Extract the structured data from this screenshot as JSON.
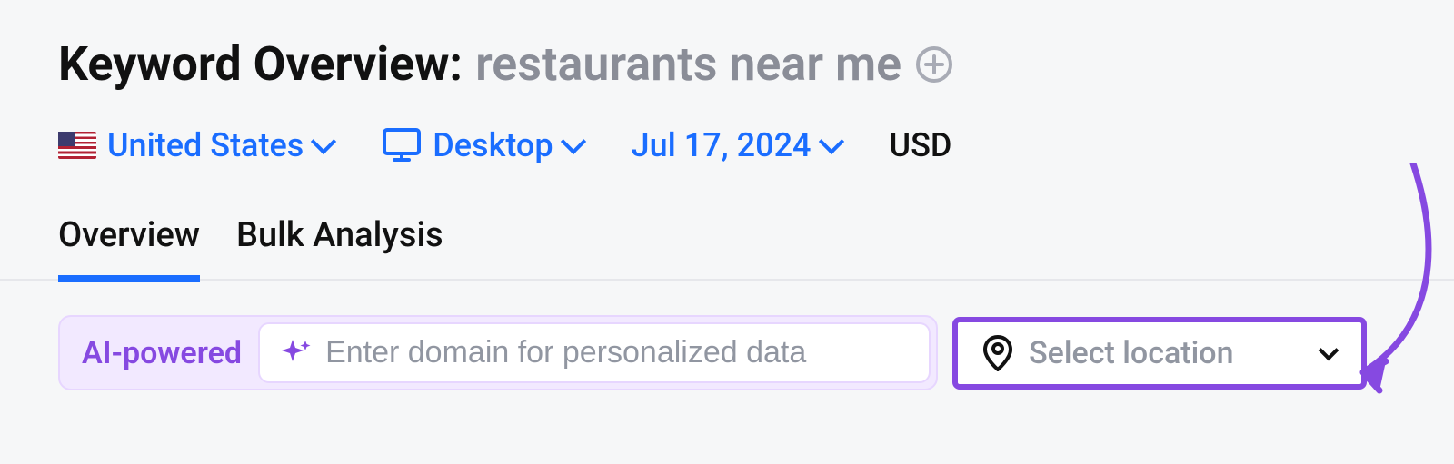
{
  "header": {
    "title_static": "Keyword Overview:",
    "keyword": "restaurants near me"
  },
  "filters": {
    "country": "United States",
    "device": "Desktop",
    "date": "Jul 17, 2024",
    "currency": "USD"
  },
  "tabs": {
    "overview": "Overview",
    "bulk": "Bulk Analysis"
  },
  "controls": {
    "ai_label": "AI-powered",
    "domain_placeholder": "Enter domain for personalized data",
    "location_placeholder": "Select location"
  },
  "colors": {
    "link_blue": "#1a6dff",
    "purple_accent": "#8649e1",
    "purple_bg": "#f2e9ff"
  }
}
